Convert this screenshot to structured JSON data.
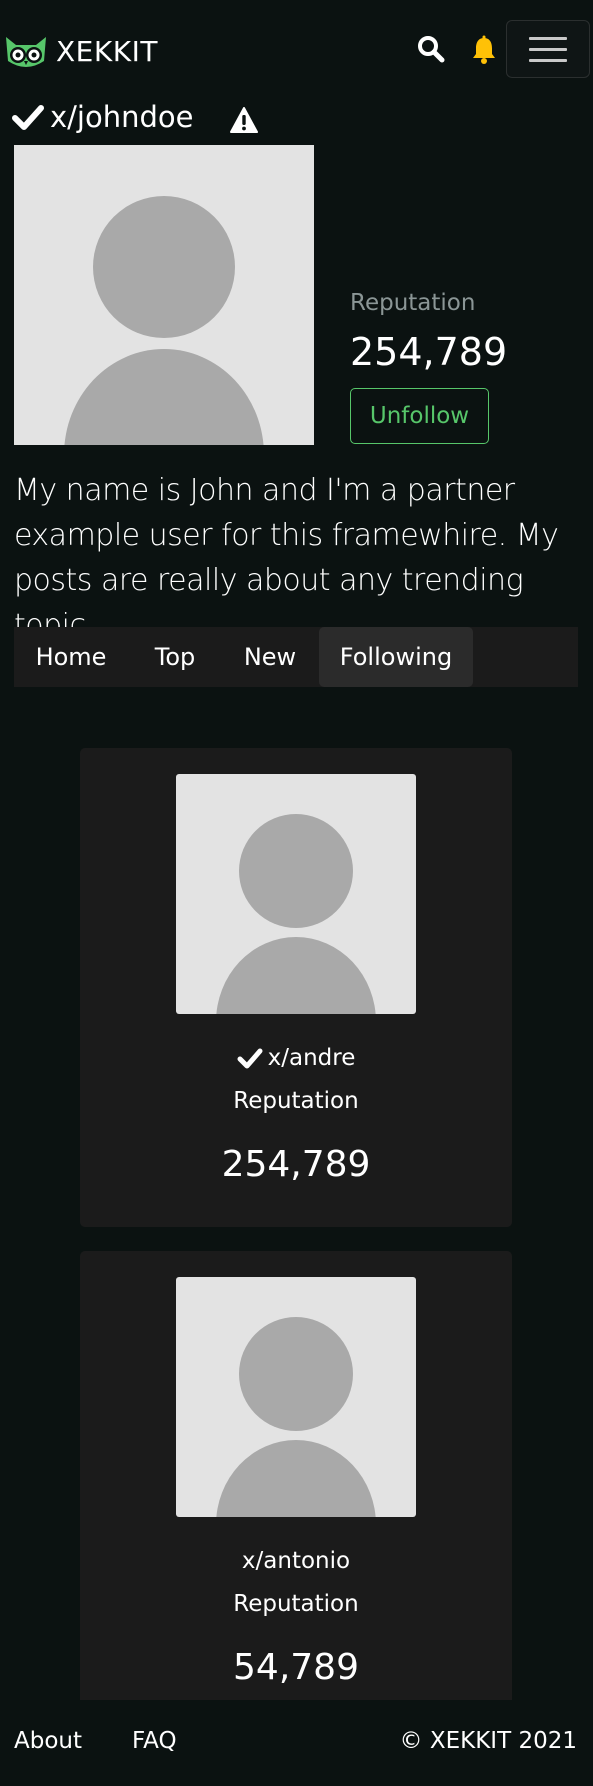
{
  "brand": {
    "name": "XEKKIT",
    "accent": "#57c66a"
  },
  "header": {
    "search_icon": "search-icon",
    "bell_icon": "bell-icon",
    "menu_icon": "hamburger-menu-icon",
    "bell_color": "#ffc107"
  },
  "profile": {
    "username": "x/johndoe",
    "verified": true,
    "reputation_label": "Reputation",
    "reputation_value": "254,789",
    "unfollow_label": "Unfollow",
    "bio": "My name is John and I'm a partner example user for this framewhire. My posts are really about any trending topic."
  },
  "tabs": [
    {
      "label": "Home",
      "active": false
    },
    {
      "label": "Top",
      "active": false
    },
    {
      "label": "New",
      "active": false
    },
    {
      "label": "Following",
      "active": true
    }
  ],
  "following": [
    {
      "name": "x/andre",
      "verified": true,
      "reputation_label": "Reputation",
      "reputation_value": "254,789"
    },
    {
      "name": "x/antonio",
      "verified": false,
      "reputation_label": "Reputation",
      "reputation_value": "54,789"
    }
  ],
  "footer": {
    "about": "About",
    "faq": "FAQ",
    "copyright": "© XEKKIT 2021"
  }
}
